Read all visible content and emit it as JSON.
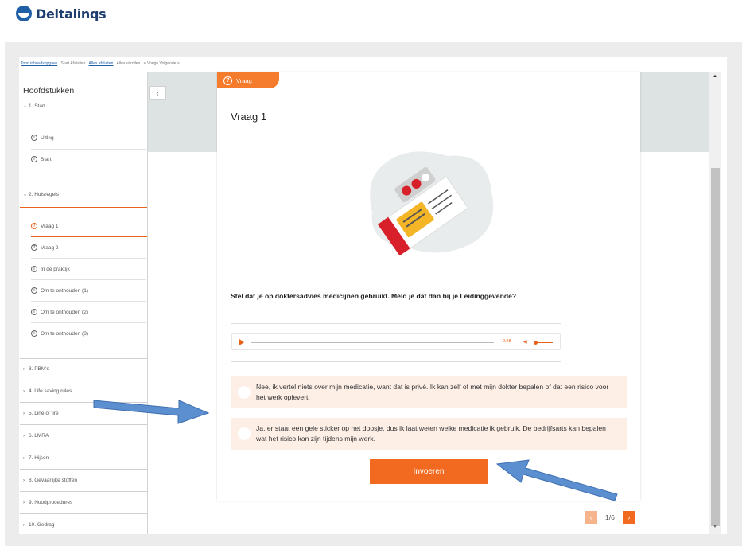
{
  "brand": {
    "name": "Deltalinqs"
  },
  "toplinks": [
    {
      "label": "Toon inhoudsopgave",
      "link": true
    },
    {
      "label": "Start Afsluiten",
      "link": false
    },
    {
      "label": "Alles afsluiten",
      "link": true
    },
    {
      "label": "Alles uitrollen",
      "link": false
    },
    {
      "label": "< Vorige Volgende >",
      "link": false
    }
  ],
  "sidebar": {
    "title": "Hoofdstukken",
    "chapter1": {
      "label": "1. Start",
      "items": [
        "Uitleg",
        "Start"
      ]
    },
    "chapter2": {
      "label": "2. Huisregels",
      "items": [
        "Vraag 1",
        "Vraag 2",
        "In de praktijk",
        "Om te onthouden (1)",
        "Om te onthouden (2)",
        "Om te onthouden (3)"
      ]
    },
    "chapters": [
      "3. PBM's",
      "4. Life saving rules",
      "5. Line of fire",
      "6. LMRA",
      "7. Hijsen",
      "8. Gevaarlijke stoffen",
      "9. Noodprocedures",
      "10. Gedrag"
    ]
  },
  "card": {
    "tag": "Vraag",
    "title": "Vraag 1",
    "question": "Stel dat je op doktersadvies medicijnen gebruikt. Meld je dat dan bij je Leidinggevende?",
    "audio_time": "-0:28",
    "options": [
      "Nee, ik vertel niets over mijn medicatie, want dat is privé. Ik kan zelf of met mijn dokter bepalen of dat een risico voor het werk oplevert.",
      "Ja, er staat een gele sticker op het doosje, dus ik laat weten welke medicatie ik gebruik. De bedrijfsarts kan bepalen wat het risico kan zijn tijdens mijn werk."
    ],
    "submit_label": "Invoeren"
  },
  "pager": {
    "current": "1/6"
  },
  "colors": {
    "accent": "#f26a1f",
    "brand": "#1f5fa8",
    "arrow": "#5b8fcf"
  }
}
